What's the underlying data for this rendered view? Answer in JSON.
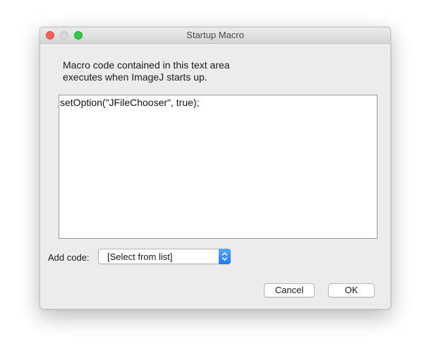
{
  "window": {
    "title": "Startup Macro"
  },
  "description": {
    "line1": "Macro code contained in this text area",
    "line2": "executes when ImageJ starts up."
  },
  "editor": {
    "code": "setOption(\"JFileChooser\", true);"
  },
  "add_code": {
    "label": "Add code:",
    "selected": "[Select from list]"
  },
  "buttons": {
    "cancel": "Cancel",
    "ok": "OK"
  },
  "colors": {
    "close": "#fc605c",
    "minimize": "#d8d8d8",
    "maximize": "#34c84a",
    "select_accent": "#1c7cf2"
  }
}
